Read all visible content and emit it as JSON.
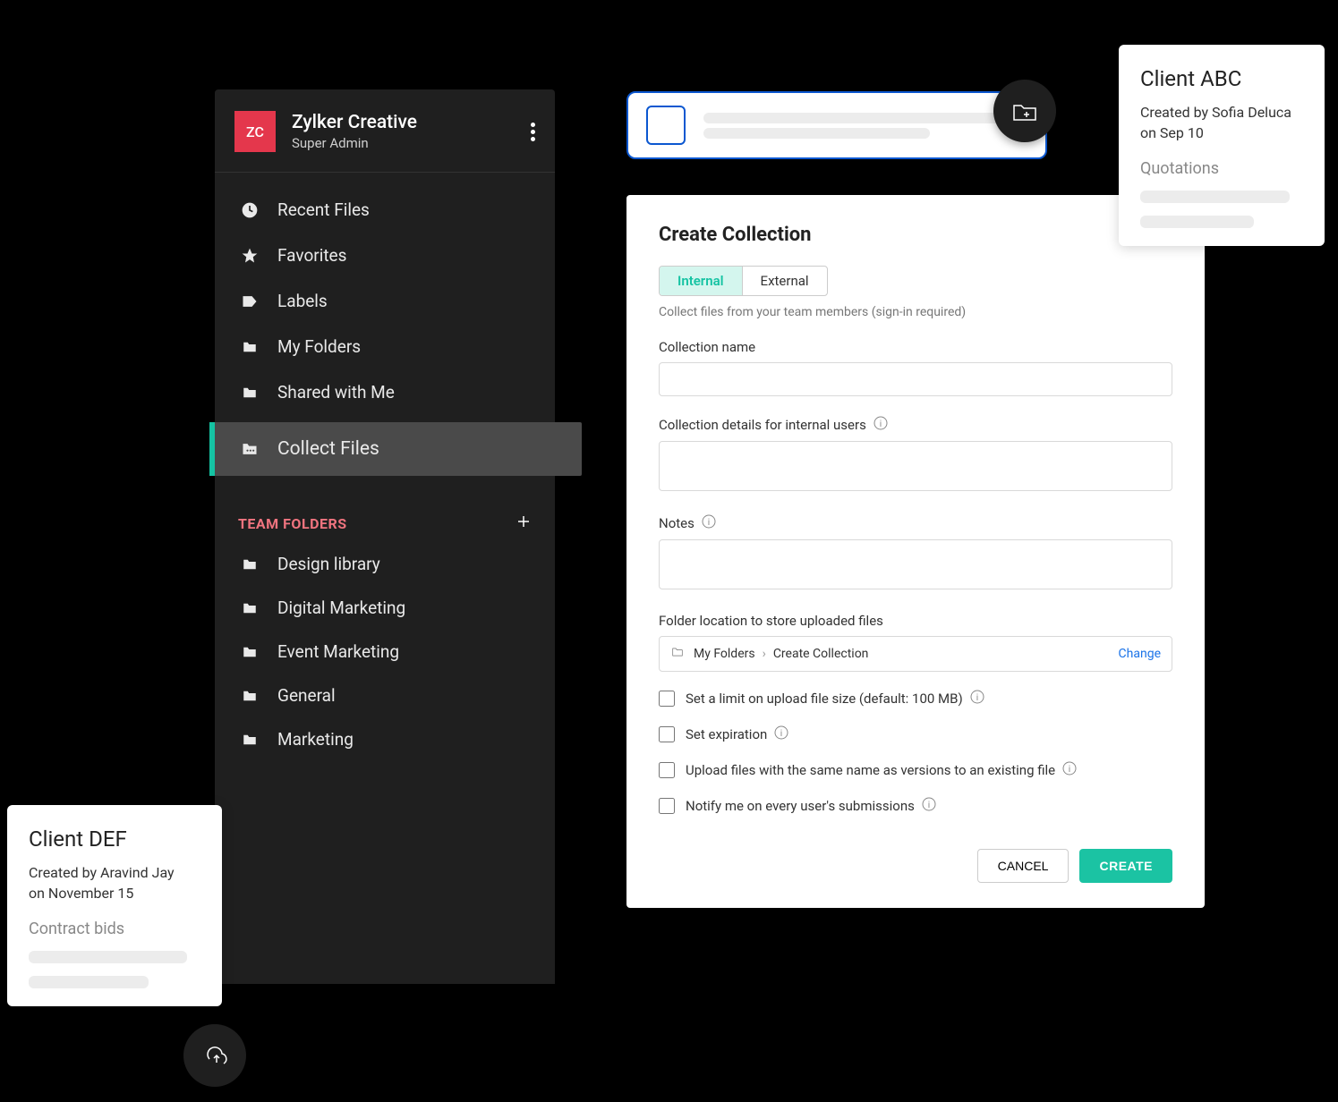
{
  "brand": {
    "logo_text": "ZC",
    "name": "Zylker Creative",
    "role": "Super Admin"
  },
  "nav": [
    {
      "icon": "clock",
      "label": "Recent Files"
    },
    {
      "icon": "star",
      "label": "Favorites"
    },
    {
      "icon": "tag",
      "label": "Labels"
    },
    {
      "icon": "folder",
      "label": "My Folders"
    },
    {
      "icon": "folder",
      "label": "Shared with Me"
    },
    {
      "icon": "folder-dots",
      "label": "Collect Files",
      "active": true
    }
  ],
  "team_section_title": "TEAM FOLDERS",
  "team_folders": [
    "Design library",
    "Digital Marketing",
    "Event Marketing",
    "General",
    "Marketing"
  ],
  "panel": {
    "title": "Create Collection",
    "tabs": {
      "internal": "Internal",
      "external": "External"
    },
    "tab_note": "Collect files from your team members (sign-in required)",
    "labels": {
      "name": "Collection name",
      "details": "Collection details for internal users",
      "notes": "Notes",
      "folder": "Folder location to store uploaded files"
    },
    "folder_path": {
      "root": "My Folders",
      "leaf": "Create Collection",
      "change": "Change"
    },
    "checks": [
      "Set a limit on upload file size (default: 100 MB)",
      "Set expiration",
      "Upload files with the same name as versions to an existing file",
      "Notify me on every user's submissions"
    ],
    "actions": {
      "cancel": "CANCEL",
      "create": "CREATE"
    }
  },
  "card_def": {
    "title": "Client DEF",
    "line1": "Created by Aravind Jay",
    "line2": "on November 15",
    "section": "Contract bids"
  },
  "card_abc": {
    "title": "Client ABC",
    "line1": "Created by Sofia Deluca",
    "line2": "on Sep 10",
    "section": "Quotations"
  }
}
